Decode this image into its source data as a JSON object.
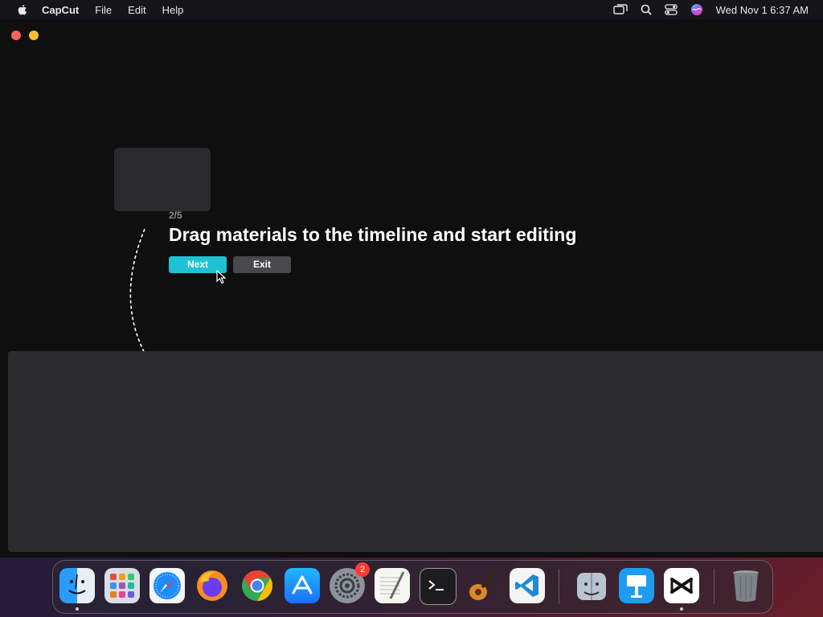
{
  "menubar": {
    "app_name": "CapCut",
    "menus": [
      "File",
      "Edit",
      "Help"
    ],
    "clock": "Wed Nov 1  6:37 AM"
  },
  "onboarding": {
    "step": "2/5",
    "title": "Drag materials to the timeline and start editing",
    "next_label": "Next",
    "exit_label": "Exit"
  },
  "dock": {
    "badge_count": "2",
    "apps": [
      "finder",
      "launchpad",
      "safari",
      "firefox",
      "chrome",
      "app-store",
      "system-settings",
      "textedit",
      "terminal",
      "garageband",
      "vscode",
      "migration-assistant",
      "keynote",
      "capcut",
      "trash"
    ]
  },
  "colors": {
    "accent": "#1ec2d3",
    "exit_button": "#49494d",
    "background": "#0f0f0f",
    "timeline": "#2b2b2d"
  }
}
